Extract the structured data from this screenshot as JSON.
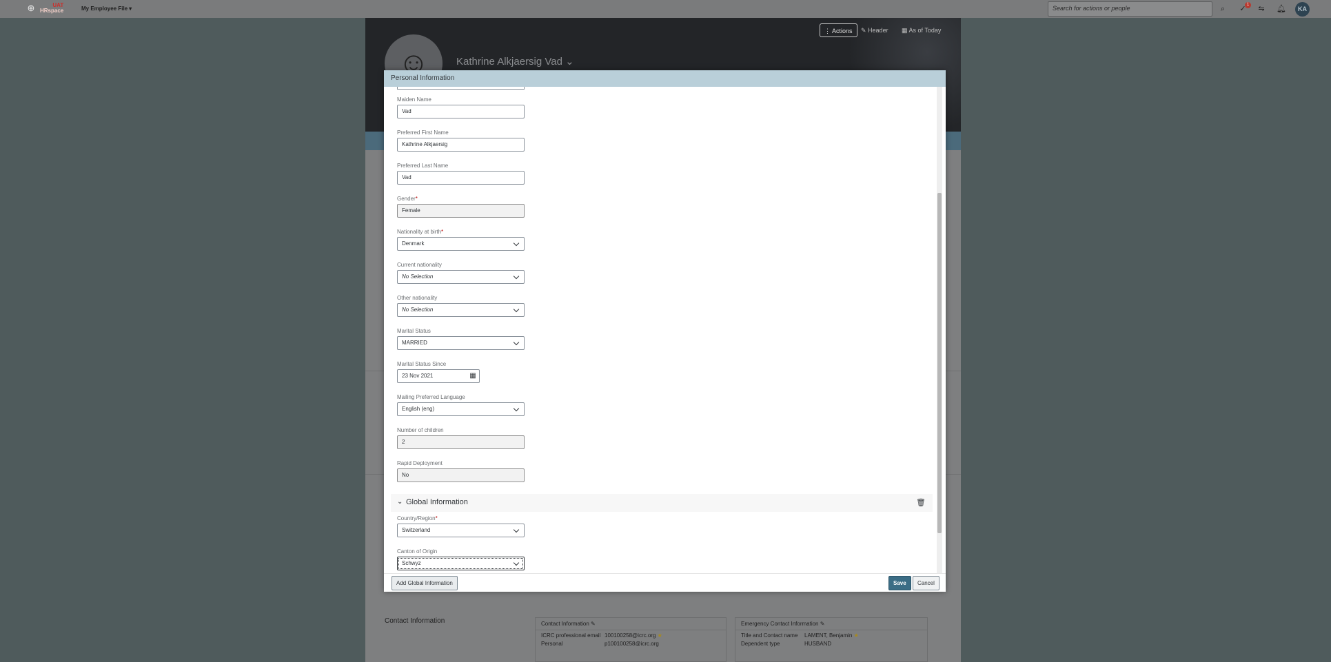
{
  "shell": {
    "brand": "HRspace",
    "env": "UAT",
    "app_menu": "My Employee File",
    "search_placeholder": "Search for actions or people",
    "notifications_count": "1",
    "avatar_initials": "KA"
  },
  "profile": {
    "name": "Kathrine Alkjaersig Vad",
    "actions_label": "Actions",
    "header_label": "Header",
    "as_of_label": "As of Today"
  },
  "dialog": {
    "title": "Personal Information",
    "fields": {
      "maiden_name": {
        "label": "Maiden Name",
        "value": "Vad"
      },
      "preferred_first_name": {
        "label": "Preferred First Name",
        "value": "Kathrine Alkjaersig"
      },
      "preferred_last_name": {
        "label": "Preferred Last Name",
        "value": "Vad"
      },
      "gender": {
        "label": "Gender",
        "value": "Female"
      },
      "nationality_at_birth": {
        "label": "Nationality at birth",
        "value": "Denmark"
      },
      "current_nationality": {
        "label": "Current nationality",
        "value": "No Selection"
      },
      "other_nationality": {
        "label": "Other nationality",
        "value": "No Selection"
      },
      "marital_status": {
        "label": "Marital Status",
        "value": "MARRIED"
      },
      "marital_status_since": {
        "label": "Marital Status Since",
        "value": "23 Nov 2021"
      },
      "mailing_language": {
        "label": "Mailing Preferred Language",
        "value": "English (eng)"
      },
      "number_of_children": {
        "label": "Number of children",
        "value": "2"
      },
      "rapid_deployment": {
        "label": "Rapid Deployment",
        "value": "No"
      }
    },
    "global_section": {
      "title": "Global Information",
      "country": {
        "label": "Country/Region",
        "value": "Switzerland"
      },
      "canton": {
        "label": "Canton of Origin",
        "value": "Schwyz"
      }
    },
    "footer": {
      "add_global": "Add Global Information",
      "save": "Save",
      "cancel": "Cancel"
    }
  },
  "background": {
    "contact_section": "Contact Information",
    "contact_card": {
      "title": "Contact Information",
      "rows": [
        {
          "k": "ICRC professional email",
          "v": "100100258@icrc.org"
        },
        {
          "k": "Personal",
          "v": "p100100258@icrc.org"
        }
      ]
    },
    "emergency_card": {
      "title": "Emergency Contact Information",
      "rows": [
        {
          "k": "Title and Contact name",
          "v": "LAMENT, Benjamin"
        },
        {
          "k": "Dependent type",
          "v": "HUSBAND"
        }
      ]
    }
  },
  "colors": {
    "accent": "#3b6d85",
    "dialog_header": "#b9cfd9",
    "required": "#bb0000"
  }
}
